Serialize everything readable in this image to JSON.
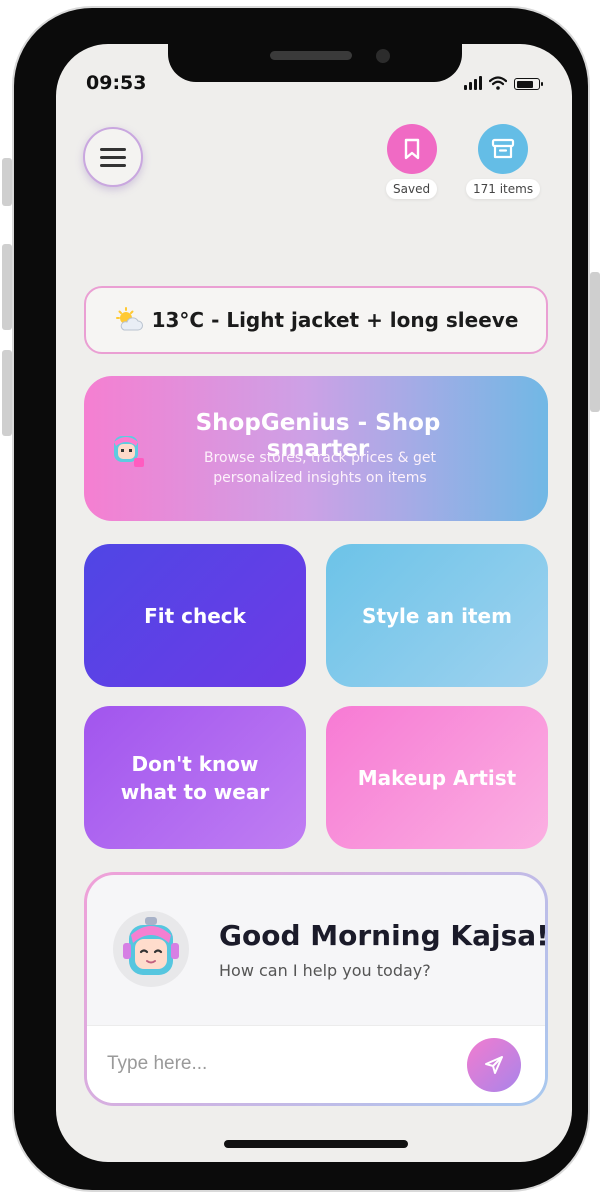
{
  "status_bar": {
    "time": "09:53"
  },
  "header": {
    "saved_label": "Saved",
    "items_label": "171 items"
  },
  "weather": {
    "icon": "partly-sunny-icon",
    "text": "13°C - Light jacket + long sleeve"
  },
  "shopgenius": {
    "title": "ShopGenius - Shop smarter",
    "subtitle": "Browse stores, track prices & get personalized insights on items"
  },
  "tiles": {
    "fit_check": "Fit check",
    "style_item": "Style an item",
    "dont_know": "Don't know what to wear",
    "makeup": "Makeup Artist"
  },
  "chat": {
    "greeting": "Good Morning Kajsa!",
    "prompt": "How can I help you today?",
    "placeholder": "Type here..."
  },
  "colors": {
    "pink": "#f06ac4",
    "blue": "#64bde6",
    "indigo": "#4f46e5",
    "purple": "#a155ee"
  }
}
